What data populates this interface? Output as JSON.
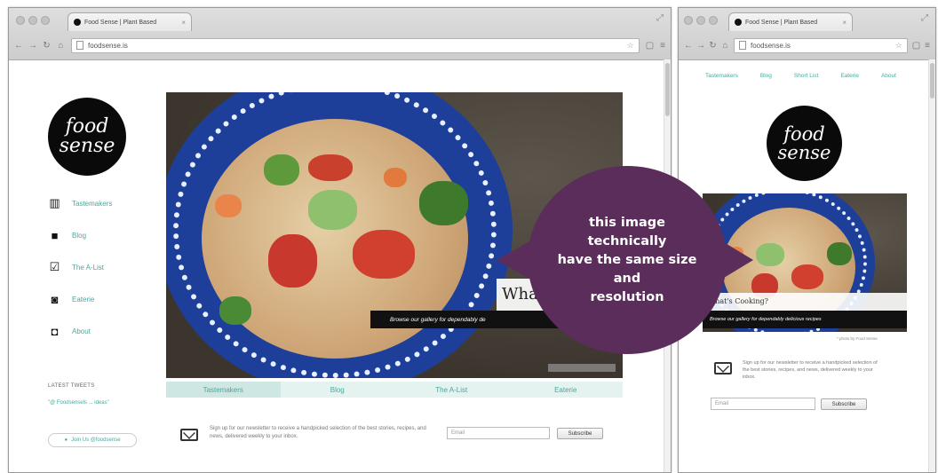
{
  "left_window": {
    "tab_title": "Food Sense | Plant Based",
    "url": "foodsense.is",
    "logo": {
      "line1": "food",
      "line2": "sense"
    },
    "menu": [
      {
        "label": "Tastemakers",
        "icon": "shelf-icon"
      },
      {
        "label": "Blog",
        "icon": "book-icon"
      },
      {
        "label": "The A-List",
        "icon": "checklist-icon"
      },
      {
        "label": "Eaterie",
        "icon": "camera-icon"
      },
      {
        "label": "About",
        "icon": "profile-icon"
      }
    ],
    "latest_tweets_title": "LATEST TWEETS",
    "tweet": "\"@ Foodsensels ... ideas\"",
    "follow_label": "Join Us @foodsense",
    "hero_heading": "Wha",
    "hero_caption": "Browse our gallery for dependably de",
    "tabs": [
      "Tastemakers",
      "Blog",
      "The A-List",
      "Eaterie"
    ],
    "newsletter_text": "Sign up for our newsletter to receive a handpicked selection of the best stories, recipes, and news, delivered weekly to your inbox.",
    "email_placeholder": "Email",
    "subscribe_label": "Subscribe"
  },
  "right_window": {
    "tab_title": "Food Sense | Plant Based",
    "url": "foodsense.is",
    "nav": [
      "Tastemakers",
      "Blog",
      "Short List",
      "Eaterie",
      "About"
    ],
    "logo": {
      "line1": "food",
      "line2": "sense"
    },
    "hero_heading": "What's Cooking?",
    "hero_caption": "Browse our gallery for dependably delicious recipes",
    "photo_credit": "* photo by Food Sense",
    "newsletter_text": "Sign up for our newsletter to receive a handpicked selection of the best stories, recipes, and news, delivered weekly to your inbox.",
    "email_placeholder": "Email",
    "subscribe_label": "Subscribe"
  },
  "annotation": {
    "lines": [
      "this image",
      "technically",
      "have the same size",
      "and",
      "resolution"
    ],
    "color": "#5b2d5a"
  },
  "accent_color": "#4aa89e"
}
